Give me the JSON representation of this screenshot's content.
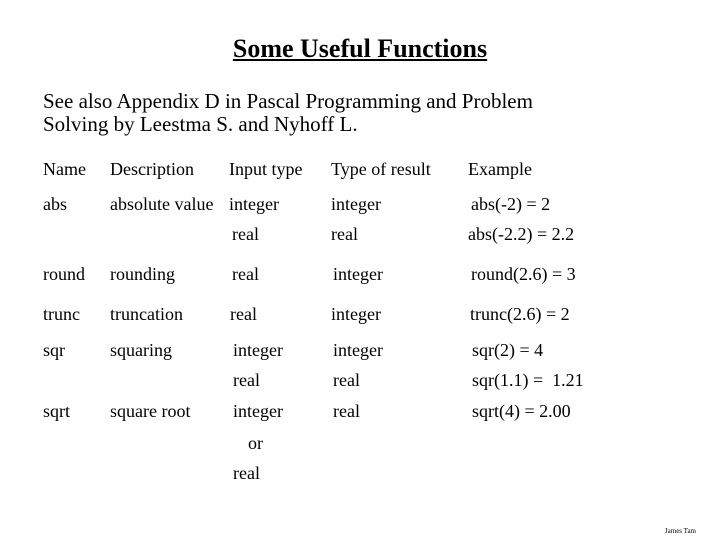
{
  "slide": {
    "title": "Some Useful Functions",
    "intro_line1": "See also Appendix D in Pascal Programming and Problem",
    "intro_line2": "Solving by Leestma S. and Nyhoff L.",
    "footer": "James Tam"
  },
  "table": {
    "headers": [
      "Name",
      "Description",
      "Input type",
      "Type of result",
      "Example"
    ],
    "rows": [
      {
        "name": "abs",
        "description": "absolute value",
        "input": "integer",
        "result": "integer",
        "example": "abs(-2) = 2"
      },
      {
        "name": "",
        "description": "",
        "input": "real",
        "result": "real",
        "example": "abs(-2.2) = 2.2"
      },
      {
        "name": "round",
        "description": "rounding",
        "input": "real",
        "result": "integer",
        "example": "round(2.6) = 3"
      },
      {
        "name": "trunc",
        "description": "truncation",
        "input": "real",
        "result": "integer",
        "example": "trunc(2.6) = 2"
      },
      {
        "name": "sqr",
        "description": "squaring",
        "input": "integer",
        "result": "integer",
        "example": "sqr(2) = 4"
      },
      {
        "name": "",
        "description": "",
        "input": "real",
        "result": "real",
        "example": "sqr(1.1) =  1.21"
      },
      {
        "name": "sqrt",
        "description": "square root",
        "input": "integer",
        "result": "real",
        "example": "sqrt(4) = 2.00"
      },
      {
        "name": "",
        "description": "",
        "input": "or",
        "result": "",
        "example": ""
      },
      {
        "name": "",
        "description": "",
        "input": "real",
        "result": "",
        "example": ""
      }
    ]
  }
}
